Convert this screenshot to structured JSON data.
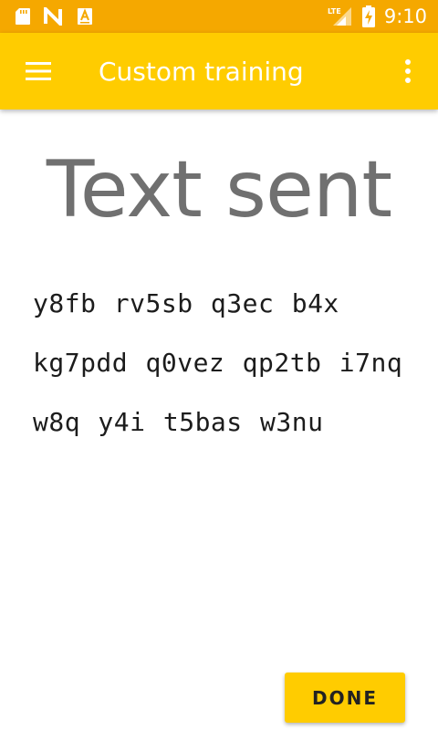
{
  "status_bar": {
    "time": "9:10",
    "network_label": "LTE",
    "icons": [
      "sd-card-icon",
      "n-notification-icon",
      "app-notification-icon",
      "lte-signal-icon",
      "battery-charging-icon"
    ]
  },
  "app_bar": {
    "title": "Custom training",
    "menu_icon": "hamburger-menu-icon",
    "overflow_icon": "more-vert-icon"
  },
  "main": {
    "heading": "Text sent",
    "body_text": "y8fb rv5sb q3ec b4x kg7pdd q0vez qp2tb i7nq w8q y4i t5bas w3nu"
  },
  "actions": {
    "done_label": "DONE"
  },
  "colors": {
    "status_bar": "#f5a800",
    "app_bar": "#ffcc00",
    "heading_text": "#707070",
    "button": "#ffcc00"
  }
}
